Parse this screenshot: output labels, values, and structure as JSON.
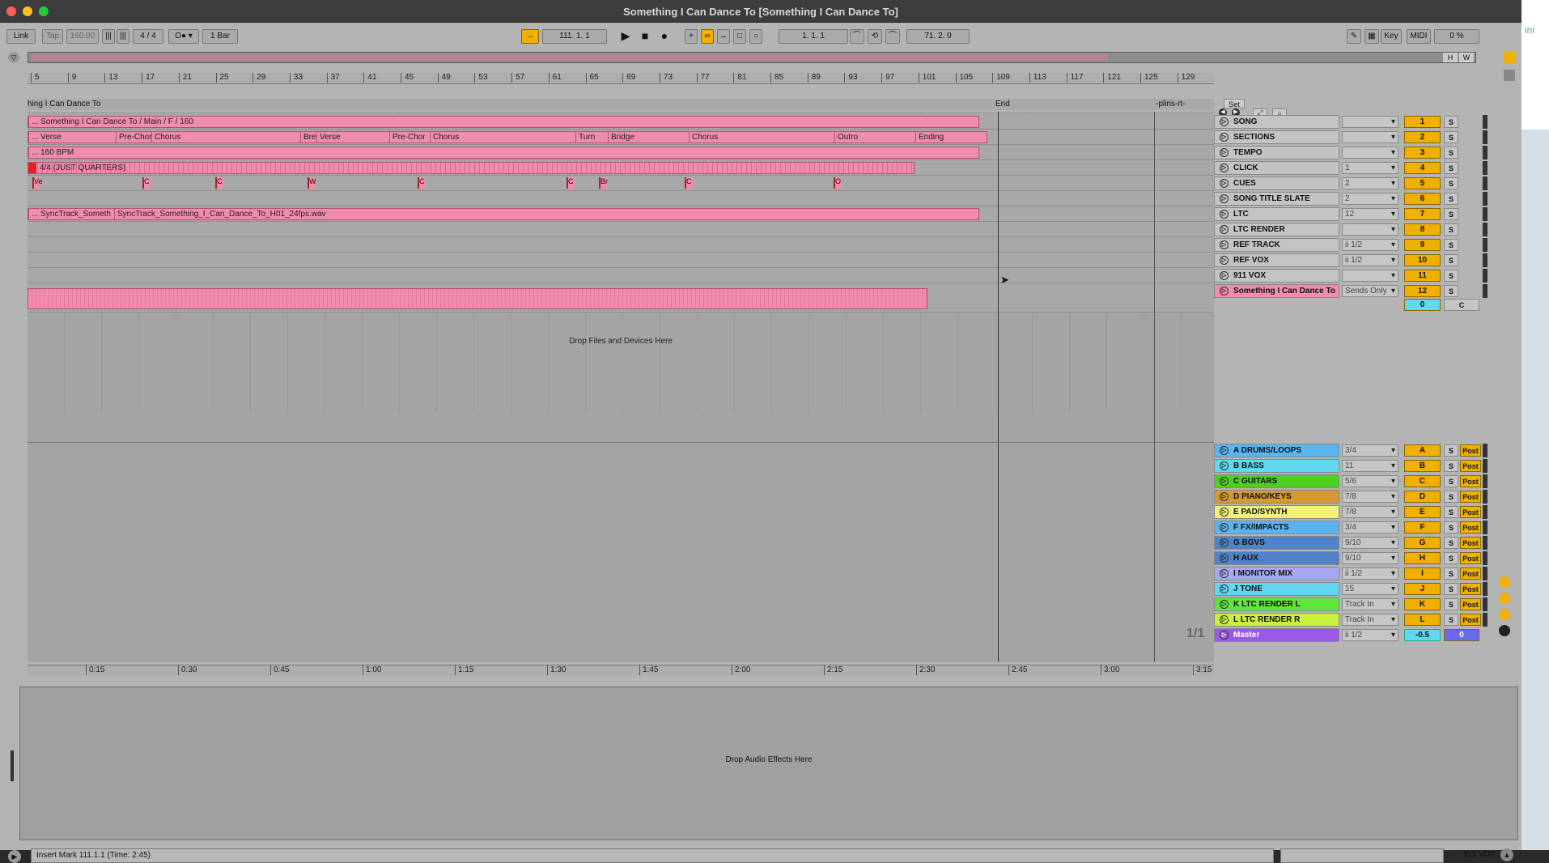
{
  "window": {
    "title": "Something I Can Dance To  [Something I Can Dance To]"
  },
  "controlbar": {
    "link": "Link",
    "tap": "Tap",
    "tempo": "160.00",
    "signature": "4 / 4",
    "quantize": "1 Bar",
    "arrangement_position": "111.  1.  1",
    "loop_start": "1.  1.  1",
    "loop_length": "71.  2.  0",
    "key": "Key",
    "midi": "MIDI",
    "cpu": "0 %"
  },
  "overview": {
    "h": "H",
    "w": "W"
  },
  "ruler": {
    "bars": [
      "5",
      "9",
      "13",
      "17",
      "21",
      "25",
      "29",
      "33",
      "37",
      "41",
      "45",
      "49",
      "53",
      "57",
      "61",
      "65",
      "69",
      "73",
      "77",
      "81",
      "85",
      "89",
      "93",
      "97",
      "101",
      "105",
      "109",
      "113",
      "117",
      "121",
      "125",
      "129"
    ]
  },
  "locators": {
    "song": "hing I Can Dance To",
    "end": "End",
    "spliris": "-pliris-rt-"
  },
  "clips": {
    "song": "... Something I Can Dance To / Main / F / 160",
    "sections": [
      {
        "label": "... Verse"
      },
      {
        "label": "Pre-Chor"
      },
      {
        "label": "Chorus"
      },
      {
        "label": "Brea"
      },
      {
        "label": "Verse"
      },
      {
        "label": "Pre-Chor"
      },
      {
        "label": "Chorus"
      },
      {
        "label": "Turn"
      },
      {
        "label": "Bridge"
      },
      {
        "label": "Chorus"
      },
      {
        "label": "Outro"
      },
      {
        "label": "Ending"
      }
    ],
    "tempo": "... 160 BPM",
    "click": "4/4 (JUST QUARTERS)",
    "cues": [
      "Ve",
      "C",
      "C",
      "W",
      "C",
      "C",
      "Br",
      "C",
      "O"
    ],
    "ltc": [
      "... SyncTrack_Someth",
      "SyncTrack_Something_I_Can_Dance_To_H01_24fps.wav"
    ]
  },
  "arrangement": {
    "drop_files": "Drop Files and Devices Here",
    "pager": "1/1"
  },
  "timeline": [
    "0:15",
    "0:30",
    "0:45",
    "1:00",
    "1:15",
    "1:30",
    "1:45",
    "2:00",
    "2:15",
    "2:30",
    "2:45",
    "3:00",
    "3:15"
  ],
  "mixer": {
    "set_label": "Set",
    "tracks": [
      {
        "name": "SONG",
        "io": "",
        "num": "1",
        "color": "#c3c3c3"
      },
      {
        "name": "SECTIONS",
        "io": "",
        "num": "2",
        "color": "#c3c3c3"
      },
      {
        "name": "TEMPO",
        "io": "",
        "num": "3",
        "color": "#c3c3c3"
      },
      {
        "name": "CLICK",
        "io": "1",
        "num": "4",
        "color": "#c3c3c3"
      },
      {
        "name": "CUES",
        "io": "2",
        "num": "5",
        "color": "#c3c3c3"
      },
      {
        "name": "SONG TITLE SLATE",
        "io": "2",
        "num": "6",
        "color": "#c3c3c3"
      },
      {
        "name": "LTC",
        "io": "12",
        "num": "7",
        "color": "#c3c3c3"
      },
      {
        "name": "LTC RENDER",
        "io": "",
        "num": "8",
        "color": "#c3c3c3"
      },
      {
        "name": "REF TRACK",
        "io": "ii 1/2",
        "num": "9",
        "color": "#c3c3c3"
      },
      {
        "name": "REF VOX",
        "io": "ii 1/2",
        "num": "10",
        "color": "#c3c3c3"
      },
      {
        "name": "911 VOX",
        "io": "",
        "num": "11",
        "color": "#c3c3c3"
      },
      {
        "name": "Something I Can Dance To",
        "io": "Sends Only",
        "num": "12",
        "color": "#f08cae"
      }
    ],
    "sel_extra": {
      "vol": "0",
      "pan": "C"
    },
    "returns": [
      {
        "name": "A DRUMS/LOOPS",
        "io": "3/4",
        "letter": "A",
        "color": "#59b4f0"
      },
      {
        "name": "B BASS",
        "io": "11",
        "letter": "B",
        "color": "#5fd8f0"
      },
      {
        "name": "C GUITARS",
        "io": "5/6",
        "letter": "C",
        "color": "#4fd01e"
      },
      {
        "name": "D PIANO/KEYS",
        "io": "7/8",
        "letter": "D",
        "color": "#d79a32"
      },
      {
        "name": "E PAD/SYNTH",
        "io": "7/8",
        "letter": "E",
        "color": "#f2f27a"
      },
      {
        "name": "F FX/IMPACTS",
        "io": "3/4",
        "letter": "F",
        "color": "#59b4f0"
      },
      {
        "name": "G BGVS",
        "io": "9/10",
        "letter": "G",
        "color": "#4f82c8"
      },
      {
        "name": "H AUX",
        "io": "9/10",
        "letter": "H",
        "color": "#4f82c8"
      },
      {
        "name": "I MONITOR MIX",
        "io": "ii 1/2",
        "letter": "I",
        "color": "#a8a8f2"
      },
      {
        "name": "J TONE",
        "io": "15",
        "letter": "J",
        "color": "#5fd8f0"
      },
      {
        "name": "K LTC RENDER L",
        "io": "Track In",
        "letter": "K",
        "color": "#5fe63c"
      },
      {
        "name": "L LTC RENDER R",
        "io": "Track In",
        "letter": "L",
        "color": "#c8f03c"
      }
    ],
    "master": {
      "name": "Master",
      "io": "ii 1/2",
      "vol": "-0.5",
      "pan": "0",
      "color": "#9a5ae6"
    },
    "s": "S",
    "post": "Post"
  },
  "detail": {
    "drop_effects": "Drop Audio Effects Here"
  },
  "status": {
    "text": "Insert Mark 111.1.1 (Time: 2:45)",
    "selected_track": "911 VOX"
  }
}
